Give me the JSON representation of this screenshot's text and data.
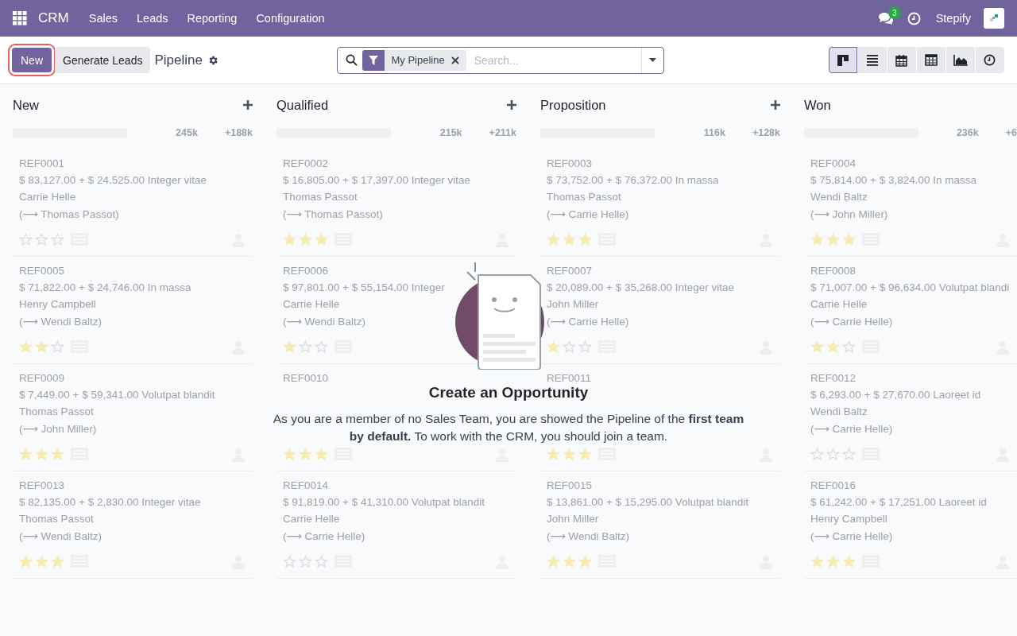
{
  "navbar": {
    "app": "CRM",
    "menu": [
      "Sales",
      "Leads",
      "Reporting",
      "Configuration"
    ],
    "messages_count": "3",
    "company": "Stepify"
  },
  "control_panel": {
    "new_button": "New",
    "generate_button": "Generate Leads",
    "title": "Pipeline",
    "search": {
      "facet": "My Pipeline",
      "placeholder": "Search..."
    },
    "views": [
      {
        "kind": "kanban",
        "selected": true
      },
      {
        "kind": "list",
        "selected": false
      },
      {
        "kind": "calendar",
        "selected": false
      },
      {
        "kind": "pivot",
        "selected": false
      },
      {
        "kind": "graph",
        "selected": false
      },
      {
        "kind": "activity",
        "selected": false
      }
    ]
  },
  "columns": [
    {
      "title": "New",
      "level": 0,
      "total": "245k",
      "recurring": "+188k",
      "cards": [
        {
          "ref": "REF0001",
          "amount": "$ 83,127.00 + $ 24,525.00 Integer vitae",
          "customer": "Carrie Helle",
          "assigned": "(⟶ Thomas Passot)",
          "stars": 0
        },
        {
          "ref": "REF0005",
          "amount": "$ 71,822.00 + $ 24,746.00 In massa",
          "customer": "Henry Campbell",
          "assigned": "(⟶ Wendi Baltz)",
          "stars": 2
        },
        {
          "ref": "REF0009",
          "amount": "$ 7,449.00 + $ 59,341.00 Volutpat blandit",
          "customer": "Thomas Passot",
          "assigned": "(⟶ John Miller)",
          "stars": 3
        },
        {
          "ref": "REF0013",
          "amount": "$ 82,135.00 + $ 2,830.00 Integer vitae",
          "customer": "Thomas Passot",
          "assigned": "(⟶ Wendi Baltz)",
          "stars": 3
        }
      ]
    },
    {
      "title": "Qualified",
      "level": 0,
      "total": "215k",
      "recurring": "+211k",
      "cards": [
        {
          "ref": "REF0002",
          "amount": "$ 16,805.00 + $ 17,397.00 Integer vitae",
          "customer": "Thomas Passot",
          "assigned": "(⟶ Thomas Passot)",
          "stars": 3
        },
        {
          "ref": "REF0006",
          "amount": "$ 97,801.00 + $ 55,154.00 Integer",
          "customer": "Carrie Helle",
          "assigned": "(⟶ Wendi Baltz)",
          "stars": 1
        },
        {
          "ref": "REF0010",
          "stars": 3
        },
        {
          "ref": "REF0014",
          "amount": "$ 91,819.00 + $ 41,310.00 Volutpat blandit",
          "customer": "Carrie Helle",
          "assigned": "(⟶ Carrie Helle)",
          "stars": 0
        }
      ]
    },
    {
      "title": "Proposition",
      "level": 0,
      "total": "116k",
      "recurring": "+128k",
      "cards": [
        {
          "ref": "REF0003",
          "amount": "$ 73,752.00 + $ 76,372.00 In massa",
          "customer": "Thomas Passot",
          "assigned": "(⟶ Carrie Helle)",
          "stars": 3
        },
        {
          "ref": "REF0007",
          "amount": "$ 20,089.00 + $ 35,268.00 Integer vitae",
          "customer": "John Miller",
          "assigned": "(⟶ Carrie Helle)",
          "stars": 1
        },
        {
          "ref": "REF0011",
          "stars": 3
        },
        {
          "ref": "REF0015",
          "amount": "$ 13,861.00 + $ 15,295.00 Volutpat blandit",
          "customer": "John Miller",
          "assigned": "(⟶ Wendi Baltz)",
          "stars": 3
        }
      ]
    },
    {
      "title": "Won",
      "level": 0,
      "total": "236k",
      "recurring": "+6",
      "cards": [
        {
          "ref": "REF0004",
          "amount": "$ 75,814.00 + $ 3,824.00 In massa",
          "customer": "Wendi Baltz",
          "assigned": "(⟶ John Miller)",
          "stars": 3
        },
        {
          "ref": "REF0008",
          "amount": "$ 71,007.00 + $ 96,634.00 Volutpat blandi",
          "customer": "Carrie Helle",
          "assigned": "(⟶ Carrie Helle)",
          "stars": 2
        },
        {
          "ref": "REF0012",
          "amount": "$ 6,293.00 + $ 27,670.00 Laoreet id",
          "customer": "Wendi Baltz",
          "assigned": "(⟶ Carrie Helle)",
          "stars": 0
        },
        {
          "ref": "REF0016",
          "amount": "$ 61,242.00 + $ 17,251.00 Laoreet id",
          "customer": "Henry Campbell",
          "assigned": "(⟶ Carrie Helle)",
          "stars": 3
        }
      ]
    }
  ],
  "help": {
    "title": "Create an Opportunity",
    "text": "As you are a member of no Sales Team, you are showed the Pipeline of the **first team by default.** To work with the CRM, you should join a team."
  }
}
